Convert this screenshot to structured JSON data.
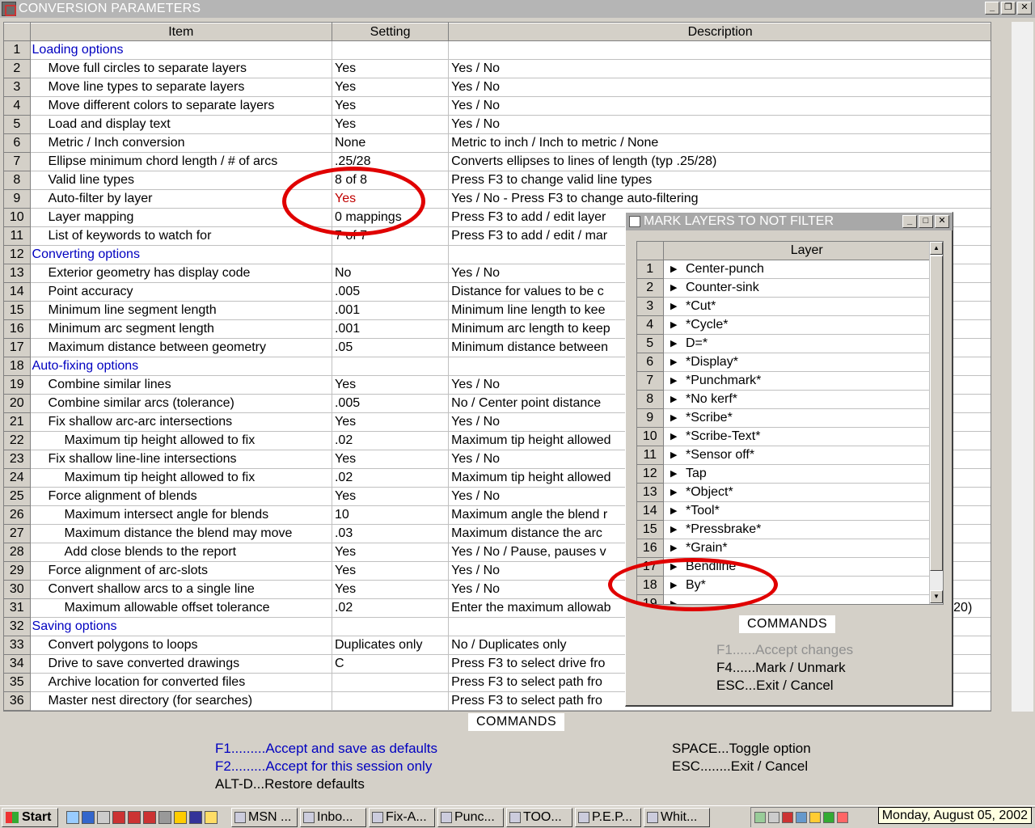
{
  "window": {
    "title": "CONVERSION PARAMETERS"
  },
  "grid": {
    "headers": {
      "item": "Item",
      "setting": "Setting",
      "description": "Description"
    },
    "rows": [
      {
        "num": "1",
        "item": "Loading options",
        "setting": "",
        "description": "",
        "style": "section"
      },
      {
        "num": "2",
        "item": "Move full circles to separate layers",
        "setting": "Yes",
        "description": "Yes / No",
        "style": "ind1"
      },
      {
        "num": "3",
        "item": "Move line types to separate layers",
        "setting": "Yes",
        "description": "Yes / No",
        "style": "ind1"
      },
      {
        "num": "4",
        "item": "Move different colors to separate layers",
        "setting": "Yes",
        "description": "Yes / No",
        "style": "ind1"
      },
      {
        "num": "5",
        "item": "Load and display text",
        "setting": "Yes",
        "description": "Yes / No",
        "style": "ind1"
      },
      {
        "num": "6",
        "item": "Metric / Inch conversion",
        "setting": "None",
        "description": "Metric to inch / Inch to metric / None",
        "style": "ind1"
      },
      {
        "num": "7",
        "item": "Ellipse minimum chord length / # of arcs",
        "setting": ".25/28",
        "description": "Converts ellipses to lines of length (typ .25/28)",
        "style": "ind1"
      },
      {
        "num": "8",
        "item": "Valid line types",
        "setting": "8 of 8",
        "description": "Press F3 to change valid line types",
        "style": "ind1"
      },
      {
        "num": "9",
        "item": "Auto-filter by layer",
        "setting": "Yes",
        "description": "Yes / No - Press F3 to change auto-filtering",
        "style": "ind1",
        "setting_red": true
      },
      {
        "num": "10",
        "item": "Layer mapping",
        "setting": "0 mappings",
        "description": "Press F3 to add / edit layer",
        "style": "ind1"
      },
      {
        "num": "11",
        "item": "List of keywords to watch for",
        "setting": "7 of 7",
        "description": "Press F3 to add / edit / mar",
        "style": "ind1"
      },
      {
        "num": "12",
        "item": "Converting options",
        "setting": "",
        "description": "",
        "style": "section"
      },
      {
        "num": "13",
        "item": "Exterior geometry has display code",
        "setting": "No",
        "description": "Yes / No",
        "style": "ind1"
      },
      {
        "num": "14",
        "item": "Point accuracy",
        "setting": ".005",
        "description": "Distance for values to be c",
        "style": "ind1"
      },
      {
        "num": "15",
        "item": "Minimum line segment length",
        "setting": ".001",
        "description": "Minimum line length to kee",
        "style": "ind1"
      },
      {
        "num": "16",
        "item": "Minimum arc segment length",
        "setting": ".001",
        "description": "Minimum arc length to keep",
        "style": "ind1"
      },
      {
        "num": "17",
        "item": "Maximum distance between geometry",
        "setting": ".05",
        "description": "Minimum distance between",
        "style": "ind1"
      },
      {
        "num": "18",
        "item": "Auto-fixing options",
        "setting": "",
        "description": "",
        "style": "section"
      },
      {
        "num": "19",
        "item": "Combine similar lines",
        "setting": "Yes",
        "description": "Yes / No",
        "style": "ind1"
      },
      {
        "num": "20",
        "item": "Combine similar arcs (tolerance)",
        "setting": ".005",
        "description": "No / Center point distance",
        "style": "ind1"
      },
      {
        "num": "21",
        "item": "Fix shallow arc-arc intersections",
        "setting": "Yes",
        "description": "Yes / No",
        "style": "ind1"
      },
      {
        "num": "22",
        "item": "Maximum tip height allowed to fix",
        "setting": ".02",
        "description": "Maximum tip height allowed",
        "style": "ind2"
      },
      {
        "num": "23",
        "item": "Fix shallow line-line intersections",
        "setting": "Yes",
        "description": "Yes / No",
        "style": "ind1"
      },
      {
        "num": "24",
        "item": "Maximum tip height allowed to fix",
        "setting": ".02",
        "description": "Maximum tip height allowed",
        "style": "ind2"
      },
      {
        "num": "25",
        "item": "Force alignment of blends",
        "setting": "Yes",
        "description": "Yes / No",
        "style": "ind1"
      },
      {
        "num": "26",
        "item": "Maximum intersect angle for blends",
        "setting": "10",
        "description": "Maximum angle the blend r",
        "style": "ind2"
      },
      {
        "num": "27",
        "item": "Maximum distance the blend may move",
        "setting": ".03",
        "description": "Maximum distance the arc",
        "style": "ind2"
      },
      {
        "num": "28",
        "item": "Add close blends to the report",
        "setting": "Yes",
        "description": "Yes / No / Pause, pauses v",
        "style": "ind2"
      },
      {
        "num": "29",
        "item": "Force alignment of arc-slots",
        "setting": "Yes",
        "description": "Yes / No",
        "style": "ind1"
      },
      {
        "num": "30",
        "item": "Convert shallow arcs to a single line",
        "setting": "Yes",
        "description": "Yes / No",
        "style": "ind1"
      },
      {
        "num": "31",
        "item": "Maximum allowable offset tolerance",
        "setting": ".02",
        "description": "Enter the maximum allowab",
        "description_tail": "20)",
        "style": "ind2"
      },
      {
        "num": "32",
        "item": "Saving options",
        "setting": "",
        "description": "",
        "style": "section"
      },
      {
        "num": "33",
        "item": "Convert polygons to loops",
        "setting": "Duplicates only",
        "description": "No / Duplicates only",
        "style": "ind1"
      },
      {
        "num": "34",
        "item": "Drive to save converted drawings",
        "setting": "C",
        "description": "Press F3 to select drive fro",
        "style": "ind1"
      },
      {
        "num": "35",
        "item": "Archive location for converted files",
        "setting": "",
        "description": "Press F3 to select path fro",
        "style": "ind1"
      },
      {
        "num": "36",
        "item": "Master nest directory (for searches)",
        "setting": "",
        "description": "Press F3 to select path fro",
        "style": "ind1"
      }
    ]
  },
  "commands": {
    "header": "COMMANDS",
    "f1": "F1.........Accept and save as defaults",
    "f2": "F2.........Accept for this session only",
    "altd": "ALT-D...Restore defaults",
    "space": "SPACE...Toggle option",
    "esc": "ESC........Exit / Cancel"
  },
  "popup": {
    "title": "MARK LAYERS TO NOT FILTER",
    "column_header": "Layer",
    "layers": [
      {
        "num": "1",
        "name": "Center-punch"
      },
      {
        "num": "2",
        "name": "Counter-sink"
      },
      {
        "num": "3",
        "name": "*Cut*"
      },
      {
        "num": "4",
        "name": "*Cycle*"
      },
      {
        "num": "5",
        "name": "D=*"
      },
      {
        "num": "6",
        "name": "*Display*"
      },
      {
        "num": "7",
        "name": "*Punchmark*"
      },
      {
        "num": "8",
        "name": "*No kerf*"
      },
      {
        "num": "9",
        "name": "*Scribe*"
      },
      {
        "num": "10",
        "name": "*Scribe-Text*"
      },
      {
        "num": "11",
        "name": "*Sensor off*"
      },
      {
        "num": "12",
        "name": "Tap"
      },
      {
        "num": "13",
        "name": "*Object*"
      },
      {
        "num": "14",
        "name": "*Tool*"
      },
      {
        "num": "15",
        "name": "*Pressbrake*"
      },
      {
        "num": "16",
        "name": "*Grain*"
      },
      {
        "num": "17",
        "name": "Bendline"
      },
      {
        "num": "18",
        "name": "By*"
      },
      {
        "num": "19",
        "name": ""
      }
    ],
    "commands_header": "COMMANDS",
    "f1": "F1......Accept changes",
    "f4": "F4......Mark / Unmark",
    "esc": "ESC...Exit / Cancel"
  },
  "taskbar": {
    "start": "Start",
    "buttons": [
      "MSN ...",
      "Inbo...",
      "Fix-A...",
      "Punc...",
      "TOO...",
      "P.E.P...",
      "Whit..."
    ],
    "clock": "Monday, August 05, 2002"
  },
  "colors": {
    "section": "#0000c0",
    "annotation": "#e00000",
    "highlight_value": "#c00000"
  }
}
